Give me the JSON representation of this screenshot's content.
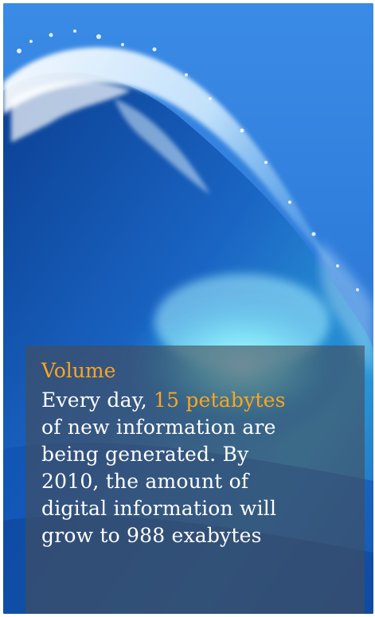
{
  "slide": {
    "heading": "Volume",
    "body_line1_prefix": "Every day, ",
    "body_line1_highlight": "15 petabytes",
    "body_line2": "of new information are",
    "body_line3": "being generated. By",
    "body_line4": "2010, the amount of",
    "body_line5": "digital information will",
    "body_line6": "grow to 988 exabytes"
  },
  "colors": {
    "accent": "#ffa51e",
    "text": "#ffffff",
    "panel": "#464e58",
    "sky": "#2f7fe0",
    "wave_deep": "#0f4fae",
    "wave_light": "#5ad8f0"
  },
  "icons": [
    "ocean-wave-image"
  ]
}
